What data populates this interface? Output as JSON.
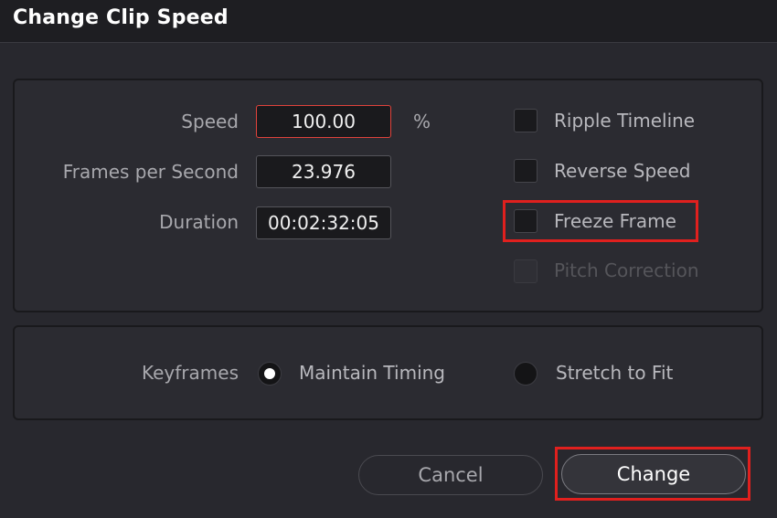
{
  "dialog": {
    "title": "Change Clip Speed"
  },
  "fields": {
    "speed": {
      "label": "Speed",
      "value": "100.00",
      "unit": "%"
    },
    "fps": {
      "label": "Frames per Second",
      "value": "23.976"
    },
    "duration": {
      "label": "Duration",
      "value": "00:02:32:05"
    }
  },
  "options": {
    "ripple": {
      "label": "Ripple Timeline",
      "checked": false
    },
    "reverse": {
      "label": "Reverse Speed",
      "checked": false
    },
    "freeze": {
      "label": "Freeze Frame",
      "checked": false
    },
    "pitch": {
      "label": "Pitch Correction",
      "checked": false,
      "disabled": true
    }
  },
  "keyframes": {
    "label": "Keyframes",
    "maintain": {
      "label": "Maintain Timing",
      "selected": true
    },
    "stretch": {
      "label": "Stretch to Fit",
      "selected": false
    }
  },
  "buttons": {
    "cancel": "Cancel",
    "change": "Change"
  },
  "colors": {
    "highlight": "#e0201e",
    "active_field_border": "#e0433c"
  }
}
